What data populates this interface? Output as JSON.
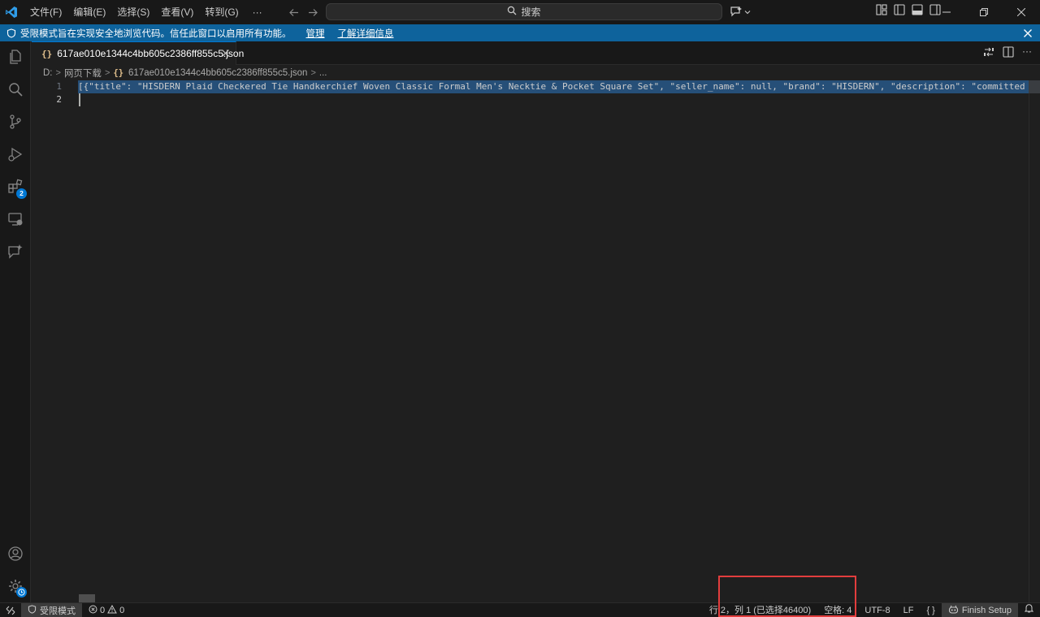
{
  "titlebar": {
    "menus": [
      "文件(F)",
      "编辑(E)",
      "选择(S)",
      "查看(V)",
      "转到(G)"
    ],
    "more": "···",
    "search_placeholder": "搜索"
  },
  "banner": {
    "message": "受限模式旨在实现安全地浏览代码。信任此窗口以启用所有功能。",
    "manage": "管理",
    "learn_more": "了解详细信息"
  },
  "activity": {
    "extensions_badge": "2"
  },
  "tab": {
    "filename": "617ae010e1344c4bb605c2386ff855c5.json",
    "icon": "{}"
  },
  "breadcrumb": {
    "drive": "D:",
    "folder": "网页下载",
    "file": "617ae010e1344c4bb605c2386ff855c5.json",
    "ellipsis": "..."
  },
  "editor": {
    "lines": [
      {
        "number": "1",
        "text": "[{\"title\": \"HISDERN Plaid Checkered Tie Handkerchief Woven Classic Formal Men's Necktie & Pocket Square Set\", \"seller_name\": null, \"brand\": \"HISDERN\", \"description\": \"committed to becom"
      },
      {
        "number": "2",
        "text": ""
      }
    ]
  },
  "statusbar": {
    "restricted_mode": "受限模式",
    "errors": "0",
    "warnings": "0",
    "position": "行 2，列 1 (已选择46400)",
    "indent": "空格: 4",
    "encoding": "UTF-8",
    "eol": "LF",
    "language": "{ }",
    "finish_setup": "Finish Setup"
  },
  "colors": {
    "accent": "#0078d4",
    "banner": "#0e639c",
    "selection": "#264f78",
    "highlight_box": "#e23d3d"
  }
}
